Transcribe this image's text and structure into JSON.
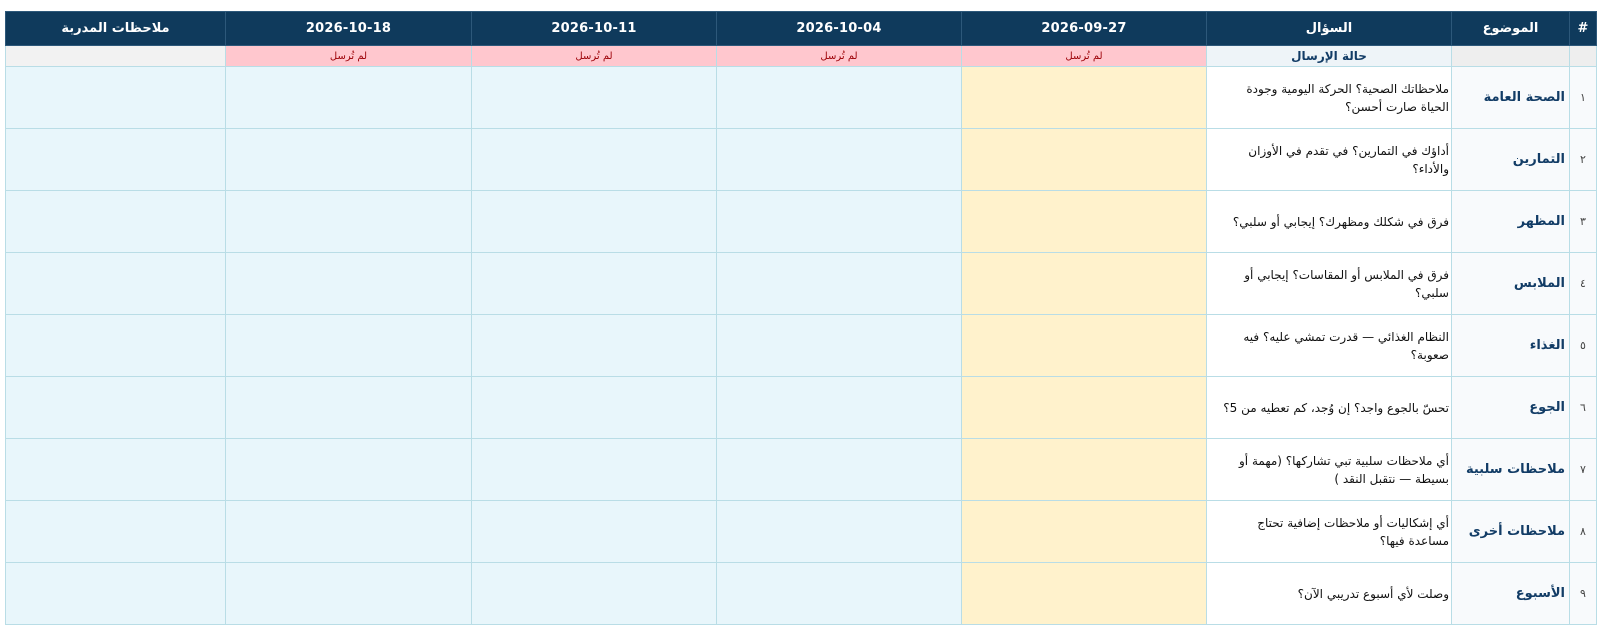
{
  "columns": {
    "num": "#",
    "topic": "الموضوع",
    "question": "السؤال",
    "dates": [
      "2026-09-27",
      "2026-10-04",
      "2026-10-11",
      "2026-10-18"
    ],
    "notes": "ملاحظات المدربة"
  },
  "status_row": {
    "title": "حالة الإرسال",
    "statuses": [
      "لم تُرسل",
      "لم تُرسل",
      "لم تُرسل",
      "لم تُرسل"
    ]
  },
  "rows": [
    {
      "num": "١",
      "topic": "الصحة العامة",
      "question": "ملاحظاتك الصحية؟ الحركة اليومية وجودة الحياة صارت أحسن؟"
    },
    {
      "num": "٢",
      "topic": "التمارين",
      "question": "أداؤك في التمارين؟ في تقدم في الأوزان والأداء؟"
    },
    {
      "num": "٣",
      "topic": "المظهر",
      "question": "فرق في شكلك ومظهرك؟ إيجابي أو سلبي؟"
    },
    {
      "num": "٤",
      "topic": "الملابس",
      "question": "فرق في الملابس أو المقاسات؟ إيجابي أو سلبي؟"
    },
    {
      "num": "٥",
      "topic": "الغذاء",
      "question": "النظام الغذائي — قدرت تمشي عليه؟ فيه صعوبة؟"
    },
    {
      "num": "٦",
      "topic": "الجوع",
      "question": "تحسّ بالجوع واجد؟ إن وُجد، كم تعطيه من 5؟"
    },
    {
      "num": "٧",
      "topic": "ملاحظات سلبية",
      "question": "أي ملاحظات سلبية تبي تشاركها؟ (مهمة أو بسيطة — نتقبل النقد     )"
    },
    {
      "num": "٨",
      "topic": "ملاحظات أخرى",
      "question": "أي إشكاليات أو ملاحظات إضافية تحتاج مساعدة فيها؟"
    },
    {
      "num": "٩",
      "topic": "الأسبوع",
      "question": "وصلت لأي أسبوع تدريبي الآن؟"
    }
  ],
  "colors": {
    "header_bg": "#0f3a5c",
    "not_sent_bg": "#ffc7ce",
    "not_sent_text": "#9c0006",
    "current_week_bg": "#fff2cc",
    "cell_bg": "#e8f6fb",
    "topic_text": "#123c66"
  }
}
